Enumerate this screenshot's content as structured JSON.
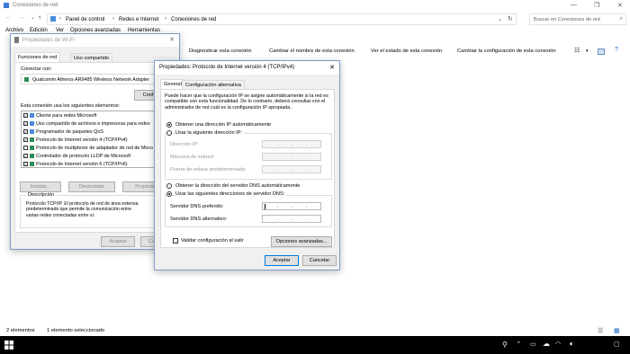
{
  "window": {
    "title": "Conexiones de red",
    "breadcrumb": [
      "Panel de control",
      "Redes e Internet",
      "Conexiones de red"
    ],
    "search_placeholder": "Buscar en Conexiones de red"
  },
  "menu": [
    "Archivo",
    "Edición",
    "Ver",
    "Opciones avanzadas",
    "Herramientas"
  ],
  "commands": [
    "Diagnosticar esta conexión",
    "Cambiar el nombre de esta conexión",
    "Ver el estado de esta conexión",
    "Cambiar la configuración de esta conexión"
  ],
  "status": {
    "items": "2 elementos",
    "selected": "1 elemento seleccionado"
  },
  "wifi_dialog": {
    "title": "Propiedades de Wi-Fi",
    "tabs": [
      "Funciones de red",
      "Uso compartido"
    ],
    "connect_label": "Conectar con:",
    "adapter": "Qualcomm Atheros AR9485 Wireless Network Adapter",
    "configure_btn": "Configurar...",
    "items_label": "Esta conexión usa los siguientes elementos:",
    "items": [
      "Cliente para redes Microsoft",
      "Uso compartido de archivos e impresoras para redes",
      "Programador de paquetes QoS",
      "Protocolo de Internet versión 4 (TCP/IPv4)",
      "Protocolo de multiplexor de adaptador de red de Micro",
      "Controlador de protocolo LLDP de Microsoft",
      "Protocolo de Internet versión 6 (TCP/IPv6)"
    ],
    "install_btn": "Instalar...",
    "uninstall_btn": "Desinstalar",
    "properties_btn": "Propiedades",
    "description_label": "Descripción",
    "description": "Protocolo TCP/IP. El protocolo de red de área extensa predeterminado que permite la comunicación entre varias redes conectadas entre sí.",
    "accept_btn": "Aceptar",
    "cancel_btn": "Cancelar"
  },
  "ipv4_dialog": {
    "title": "Propiedades: Protocolo de Internet versión 4 (TCP/IPv4)",
    "tabs": [
      "General",
      "Configuración alternativa"
    ],
    "intro": "Puede hacer que la configuración IP se asigne automáticamente si la red es compatible con esta funcionalidad. De lo contrario, deberá consultar con el administrador de red cuál es la configuración IP apropiada.",
    "auto_ip": "Obtener una dirección IP automáticamente",
    "manual_ip": "Usar la siguiente dirección IP:",
    "ip_label": "Dirección IP:",
    "mask_label": "Máscara de subred:",
    "gateway_label": "Puerta de enlace predeterminada:",
    "auto_dns": "Obtener la dirección del servidor DNS automáticamente",
    "manual_dns": "Usar las siguientes direcciones de servidor DNS:",
    "dns_pref_label": "Servidor DNS preferido:",
    "dns_alt_label": "Servidor DNS alternativo:",
    "validate_label": "Validar configuración al salir",
    "advanced_btn": "Opciones avanzadas...",
    "accept_btn": "Aceptar",
    "cancel_btn": "Cancelar"
  },
  "taskbar": {
    "time": "",
    "date": ""
  }
}
